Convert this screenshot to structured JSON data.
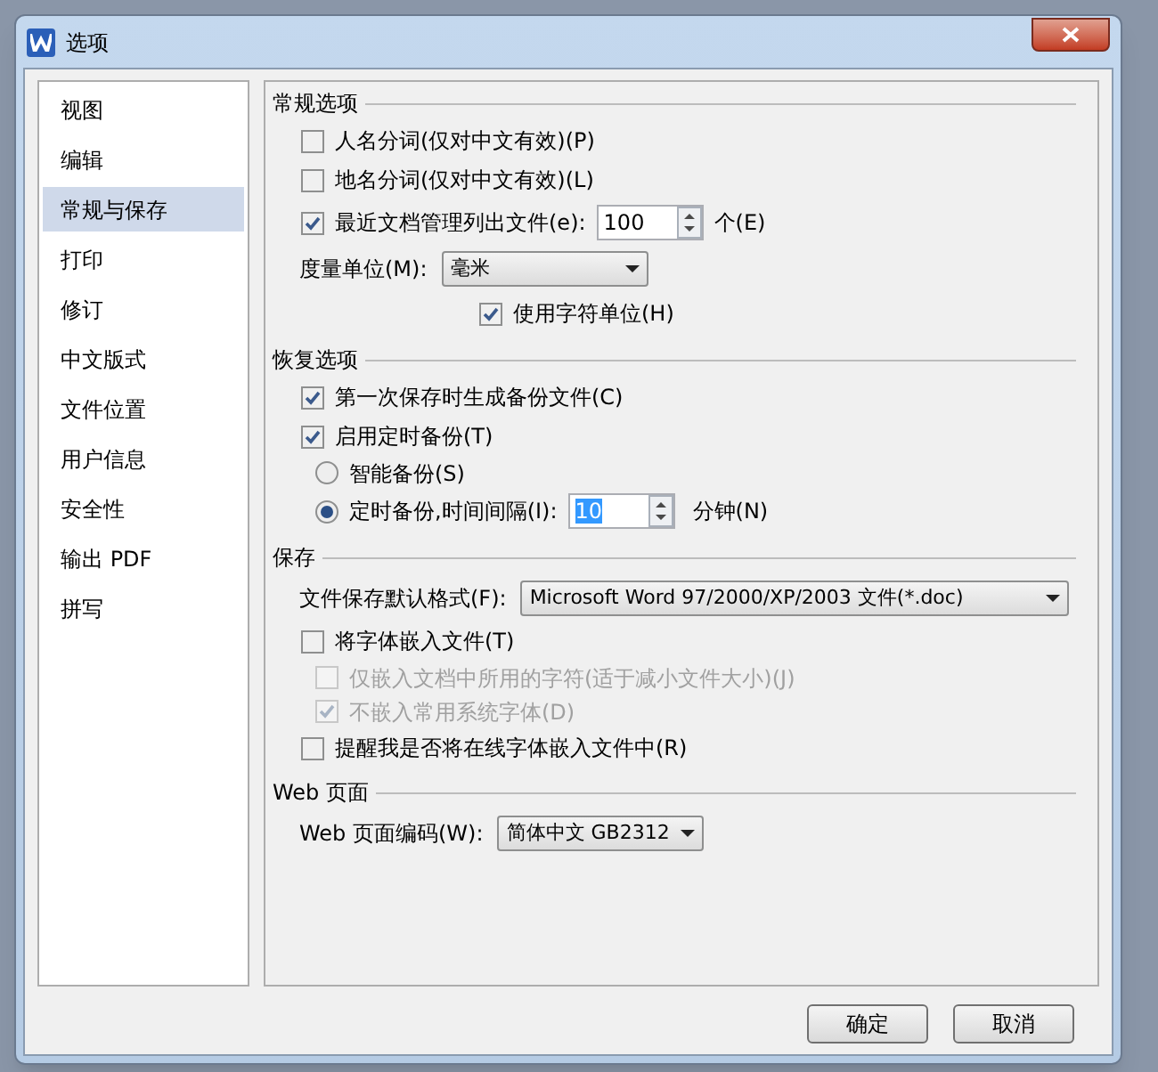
{
  "window": {
    "title": "选项"
  },
  "sidebar": {
    "items": [
      {
        "label": "视图",
        "selected": false
      },
      {
        "label": "编辑",
        "selected": false
      },
      {
        "label": "常规与保存",
        "selected": true
      },
      {
        "label": "打印",
        "selected": false
      },
      {
        "label": "修订",
        "selected": false
      },
      {
        "label": "中文版式",
        "selected": false
      },
      {
        "label": "文件位置",
        "selected": false
      },
      {
        "label": "用户信息",
        "selected": false
      },
      {
        "label": "安全性",
        "selected": false
      },
      {
        "label": "输出 PDF",
        "selected": false
      },
      {
        "label": "拼写",
        "selected": false
      }
    ]
  },
  "sections": [
    {
      "title": "常规选项",
      "rows": [
        {
          "kind": "checkbox",
          "label": "人名分词(仅对中文有效)(P)",
          "checked": false,
          "disabled": false
        },
        {
          "kind": "checkbox",
          "label": "地名分词(仅对中文有效)(L)",
          "checked": false,
          "disabled": false
        },
        {
          "kind": "checkbox_spin",
          "label": "最近文档管理列出文件(e):",
          "checked": true,
          "disabled": false,
          "value": "100",
          "suffix": "个(E)",
          "highlighted": false
        },
        {
          "kind": "select",
          "label": "度量单位(M):",
          "value": "毫米",
          "wide": false
        },
        {
          "kind": "aligned_checkbox",
          "label": "使用字符单位(H)",
          "checked": true,
          "disabled": false
        }
      ]
    },
    {
      "title": "恢复选项",
      "rows": [
        {
          "kind": "checkbox",
          "label": "第一次保存时生成备份文件(C)",
          "checked": true,
          "disabled": false
        },
        {
          "kind": "checkbox",
          "label": "启用定时备份(T)",
          "checked": true,
          "disabled": false
        },
        {
          "kind": "radio",
          "label": "智能备份(S)",
          "selected": false
        },
        {
          "kind": "radio_spin",
          "label": "定时备份,时间间隔(I):",
          "selected": true,
          "value": "10",
          "suffix": "分钟(N)",
          "highlighted": true
        }
      ]
    },
    {
      "title": "保存",
      "rows": [
        {
          "kind": "select",
          "label": "文件保存默认格式(F):",
          "value": "Microsoft Word 97/2000/XP/2003 文件(*.doc)",
          "wide": true
        },
        {
          "kind": "checkbox",
          "label": "将字体嵌入文件(T)",
          "checked": false,
          "disabled": false
        },
        {
          "kind": "sub_checkbox",
          "label": "仅嵌入文档中所用的字符(适于减小文件大小)(J)",
          "checked": false,
          "disabled": true
        },
        {
          "kind": "sub_checkbox",
          "label": "不嵌入常用系统字体(D)",
          "checked": true,
          "disabled": true
        },
        {
          "kind": "checkbox",
          "label": "提醒我是否将在线字体嵌入文件中(R)",
          "checked": false,
          "disabled": false
        }
      ]
    },
    {
      "title": "Web 页面",
      "rows": [
        {
          "kind": "select",
          "label": "Web 页面编码(W):",
          "value": "简体中文 GB2312",
          "wide": false
        }
      ]
    }
  ],
  "buttons": [
    "确定",
    "取消"
  ]
}
